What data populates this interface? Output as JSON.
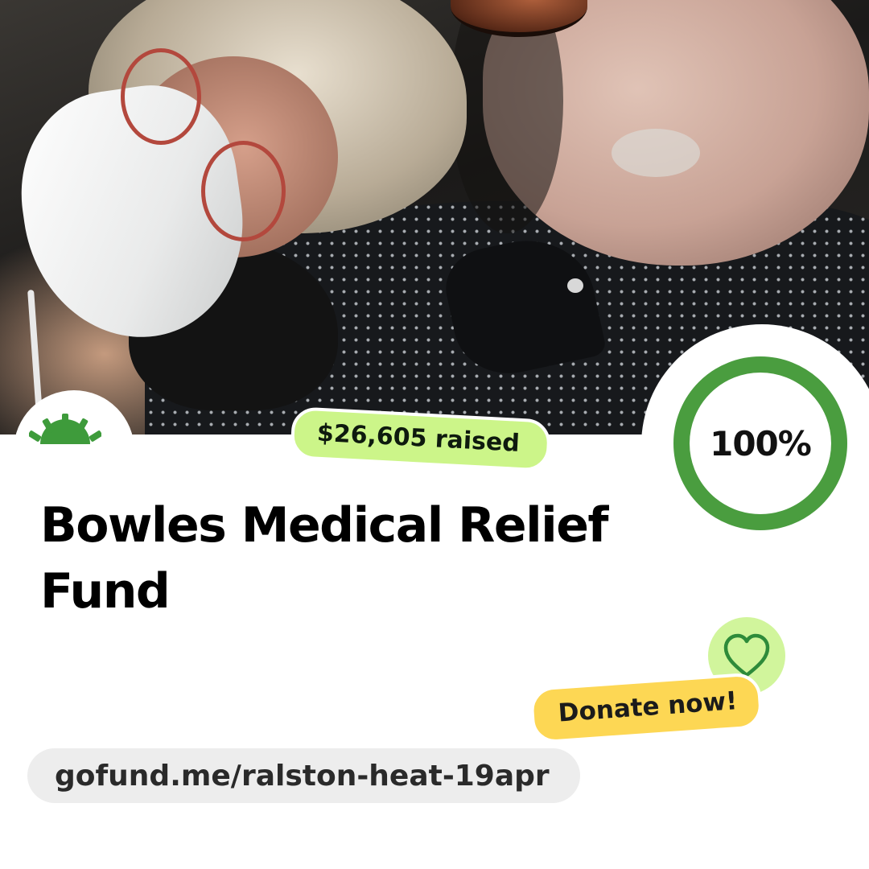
{
  "campaign": {
    "raised_text": "$26,605 raised",
    "progress_label": "100%",
    "progress_fraction": 1.0,
    "title": "Bowles Medical Relief Fund",
    "donate_label": "Donate now!",
    "url": "gofund.me/ralston-heat-19apr"
  },
  "icons": {
    "logo": "sunrise-logo-icon",
    "heart": "heart-icon"
  },
  "colors": {
    "brand_green": "#3e9b3b",
    "ring_green": "#4a9d3f",
    "raised_badge_bg": "#ccf589",
    "heart_badge_bg": "#d1f59c",
    "donate_bg": "#fdd754",
    "url_pill_bg": "#ededed"
  }
}
